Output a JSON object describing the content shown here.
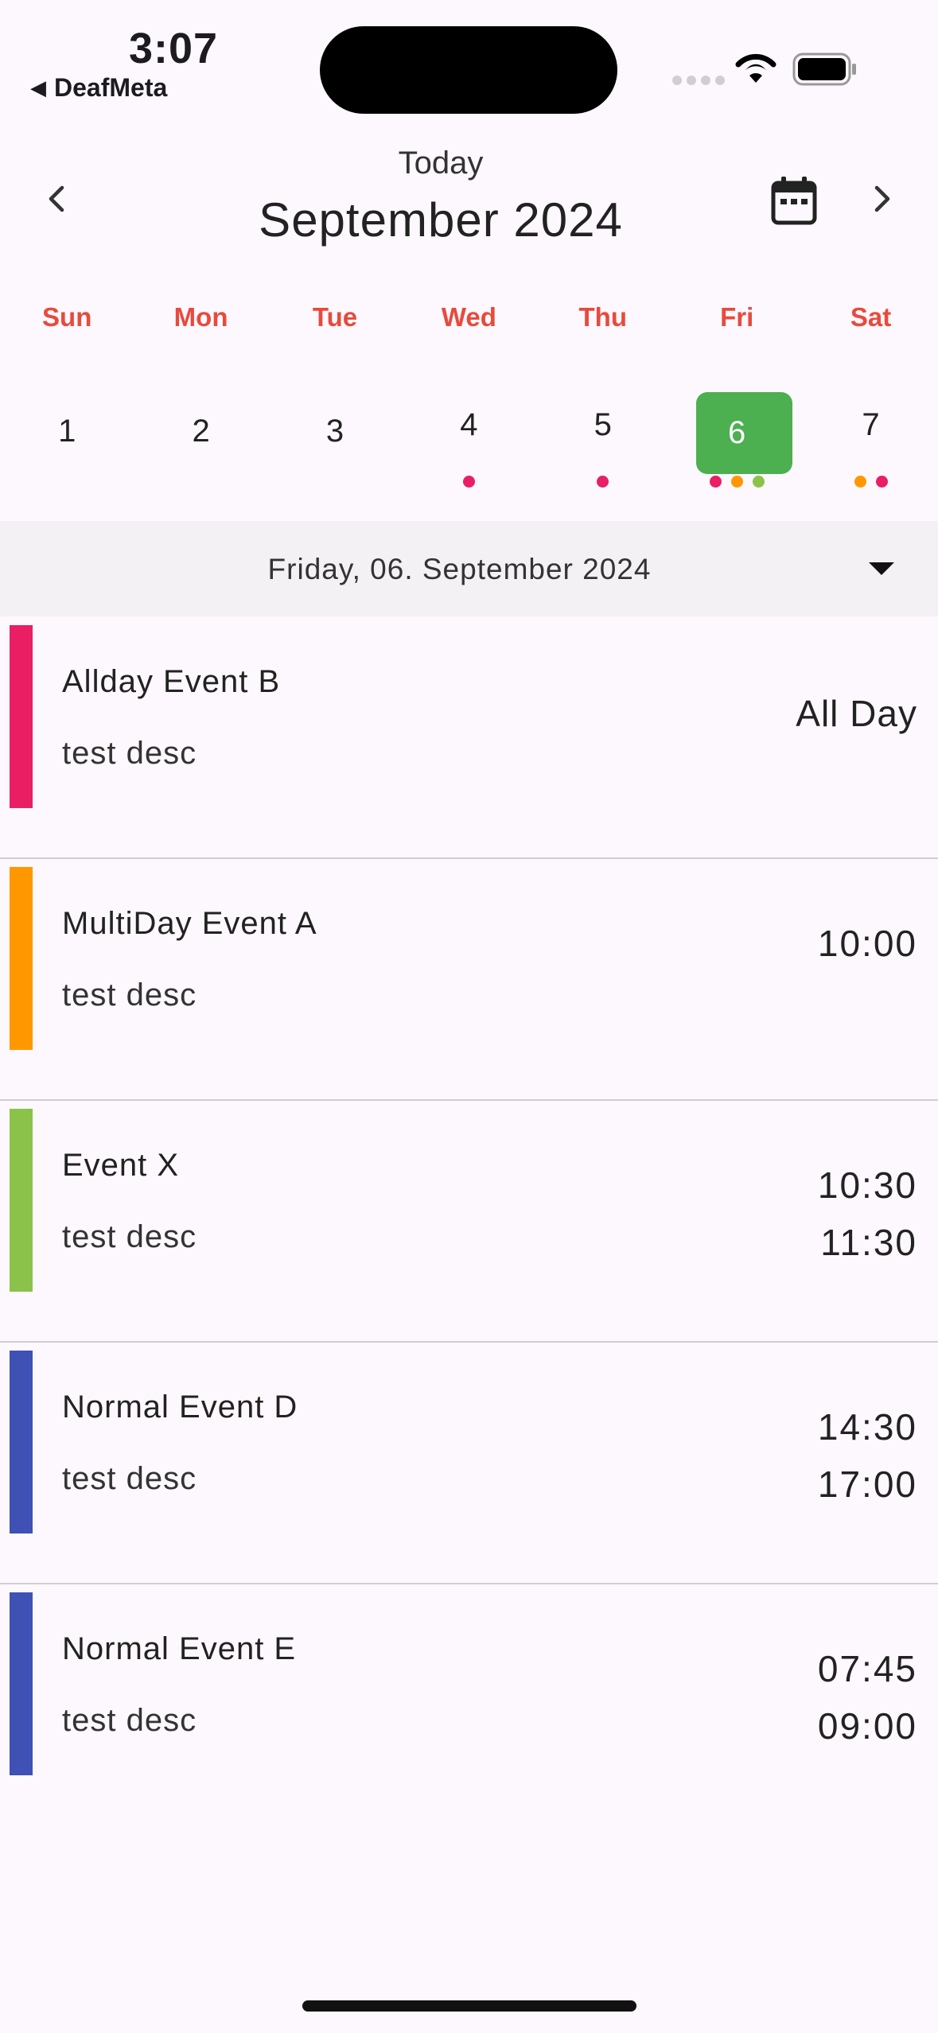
{
  "status": {
    "time": "3:07",
    "back_app": "DeafMeta"
  },
  "header": {
    "today_label": "Today",
    "month_title": "September 2024"
  },
  "weekdays": [
    "Sun",
    "Mon",
    "Tue",
    "Wed",
    "Thu",
    "Fri",
    "Sat"
  ],
  "days": [
    {
      "num": "1",
      "dots": []
    },
    {
      "num": "2",
      "dots": []
    },
    {
      "num": "3",
      "dots": []
    },
    {
      "num": "4",
      "dots": [
        "#e91e63"
      ]
    },
    {
      "num": "5",
      "dots": [
        "#e91e63"
      ]
    },
    {
      "num": "6",
      "dots": [
        "#e91e63",
        "#ff9800",
        "#8bc34a"
      ],
      "selected": true
    },
    {
      "num": "7",
      "dots": [
        "#ff9800",
        "#e91e63"
      ]
    }
  ],
  "selected_date": "Friday, 06. September 2024",
  "colors": {
    "selected_day": "#4caf50",
    "weekday": "#e84a3c"
  },
  "events": [
    {
      "title": "Allday Event B",
      "desc": "test desc",
      "all_day": "All Day",
      "color": "#e91e63"
    },
    {
      "title": "MultiDay Event A",
      "desc": "test desc",
      "start": "10:00",
      "end": "",
      "color": "#ff9800"
    },
    {
      "title": "Event X",
      "desc": "test desc",
      "start": "10:30",
      "end": "11:30",
      "color": "#8bc34a"
    },
    {
      "title": "Normal Event D",
      "desc": "test desc",
      "start": "14:30",
      "end": "17:00",
      "color": "#3f51b5"
    },
    {
      "title": "Normal Event E",
      "desc": "test desc",
      "start": "07:45",
      "end": "09:00",
      "color": "#3f51b5"
    }
  ]
}
